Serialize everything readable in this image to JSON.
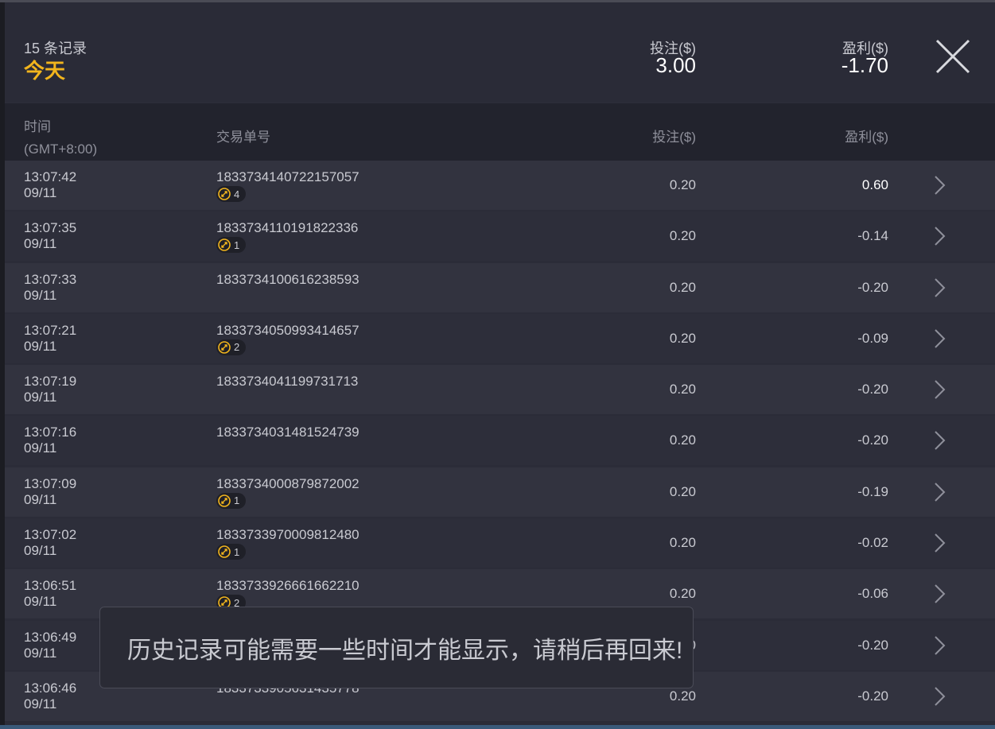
{
  "header": {
    "record_count": "15 条记录",
    "day": "今天",
    "stake_label": "投注($)",
    "stake_total": "3.00",
    "profit_label": "盈利($)",
    "profit_total": "-1.70"
  },
  "columns": {
    "time": "时间",
    "timezone": "(GMT+8:00)",
    "order_id": "交易单号",
    "stake": "投注($)",
    "profit": "盈利($)"
  },
  "rows": [
    {
      "time": "13:07:42",
      "date": "09/11",
      "id": "1833734140722157057",
      "badge": "4",
      "stake": "0.20",
      "profit": "0.60"
    },
    {
      "time": "13:07:35",
      "date": "09/11",
      "id": "1833734110191822336",
      "badge": "1",
      "stake": "0.20",
      "profit": "-0.14"
    },
    {
      "time": "13:07:33",
      "date": "09/11",
      "id": "1833734100616238593",
      "badge": "",
      "stake": "0.20",
      "profit": "-0.20"
    },
    {
      "time": "13:07:21",
      "date": "09/11",
      "id": "1833734050993414657",
      "badge": "2",
      "stake": "0.20",
      "profit": "-0.09"
    },
    {
      "time": "13:07:19",
      "date": "09/11",
      "id": "1833734041199731713",
      "badge": "",
      "stake": "0.20",
      "profit": "-0.20"
    },
    {
      "time": "13:07:16",
      "date": "09/11",
      "id": "1833734031481524739",
      "badge": "",
      "stake": "0.20",
      "profit": "-0.20"
    },
    {
      "time": "13:07:09",
      "date": "09/11",
      "id": "1833734000879872002",
      "badge": "1",
      "stake": "0.20",
      "profit": "-0.19"
    },
    {
      "time": "13:07:02",
      "date": "09/11",
      "id": "1833733970009812480",
      "badge": "1",
      "stake": "0.20",
      "profit": "-0.02"
    },
    {
      "time": "13:06:51",
      "date": "09/11",
      "id": "1833733926661662210",
      "badge": "2",
      "stake": "0.20",
      "profit": "-0.06"
    },
    {
      "time": "13:06:49",
      "date": "09/11",
      "id": "",
      "badge": "",
      "stake": "0.20",
      "profit": "-0.20"
    },
    {
      "time": "13:06:46",
      "date": "09/11",
      "id": "1833733905631435778",
      "badge": "",
      "stake": "0.20",
      "profit": "-0.20"
    }
  ],
  "toast": {
    "message": "历史记录可能需要一些时间才能显示，请稍后再回来!"
  },
  "colors": {
    "accent": "#f2b51d",
    "panel": "#2b2c38",
    "row_alt": "#2d2e3a"
  },
  "icons": {
    "close": "close-icon",
    "row_arrow": "chevron-right-icon",
    "badge": "free-spin-coin-icon"
  }
}
